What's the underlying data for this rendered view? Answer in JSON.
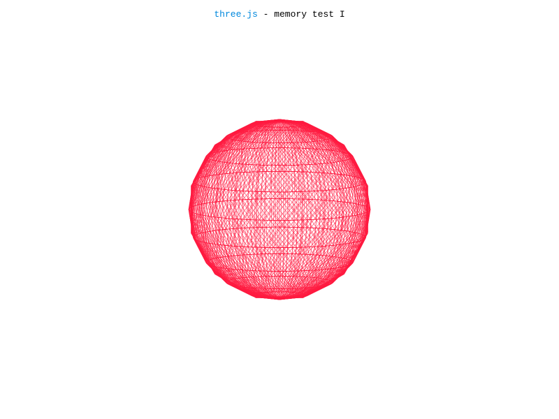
{
  "info": {
    "link_text": "three.js",
    "title_text": " - memory test I"
  },
  "colors": {
    "background": "#ffffff",
    "link": "#0088dd",
    "text": "#000000",
    "wireframe": "#ff1a40"
  },
  "scene": {
    "object": "wireframe-sphere"
  }
}
